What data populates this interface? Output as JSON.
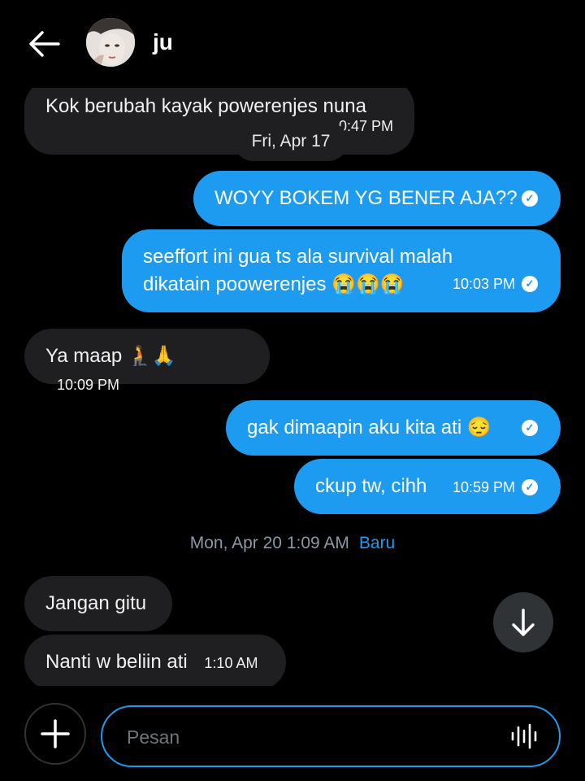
{
  "header": {
    "contact_name": "ju",
    "back_icon": "arrow-left-icon",
    "avatar": "contact-avatar"
  },
  "colors": {
    "outgoing": "#1d9bf0",
    "incoming": "#1f1f21",
    "accent": "#1d9bf0"
  },
  "messages": [
    {
      "dir": "in",
      "text": "Kok berubah kayak powerenjes nuna",
      "time": "0:47 PM"
    },
    {
      "dir": "out",
      "text": "WOYY BOKEM YG BENER AJA??",
      "time": "",
      "read": true
    },
    {
      "dir": "out",
      "text": "seeffort ini gua ts ala survival malah dikatain poowerenjes 😭😭😭",
      "line1": "seeffort ini gua ts ala survival malah",
      "line2": "dikatain poowerenjes 😭😭😭",
      "time": "10:03 PM",
      "read": true
    },
    {
      "dir": "in",
      "text": "Ya maap 🧎🙏",
      "time": "10:09 PM"
    },
    {
      "dir": "out",
      "text": "gak dimaapin aku kita ati 😔",
      "time": "",
      "read": true
    },
    {
      "dir": "out",
      "text": "ckup tw, cihh",
      "time": "10:59 PM",
      "read": true
    },
    {
      "dir": "in",
      "text": "Jangan gitu",
      "time": ""
    },
    {
      "dir": "in",
      "text": "Nanti w beliin ati",
      "time": "1:10 AM"
    }
  ],
  "date_chip": "Fri, Apr 17",
  "divider": {
    "date": "Mon, Apr 20 1:09 AM",
    "new_label": "Baru"
  },
  "composer": {
    "placeholder": "Pesan"
  }
}
